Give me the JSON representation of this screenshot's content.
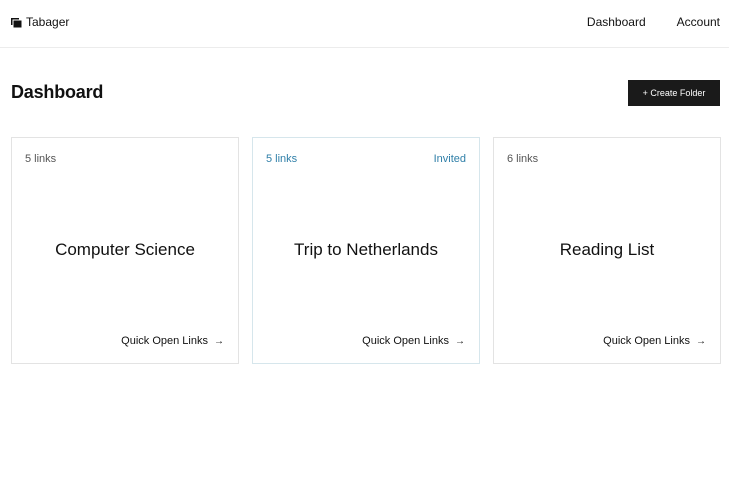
{
  "header": {
    "brand": "Tabager",
    "brand_icon": "folders-icon",
    "nav": [
      "Dashboard",
      "Account"
    ]
  },
  "main": {
    "title": "Dashboard",
    "create_button": "+ Create Folder"
  },
  "folders": [
    {
      "link_count": "5 links",
      "badge": "",
      "title": "Computer Science",
      "action": "Quick Open Links"
    },
    {
      "link_count": "5 links",
      "badge": "Invited",
      "title": "Trip to Netherlands",
      "action": "Quick Open Links"
    },
    {
      "link_count": "6 links",
      "badge": "",
      "title": "Reading List",
      "action": "Quick Open Links"
    }
  ],
  "colors": {
    "accent": "#2f7fa8",
    "button_bg": "#1a1a1a",
    "card_border": "#e3e3e3"
  }
}
